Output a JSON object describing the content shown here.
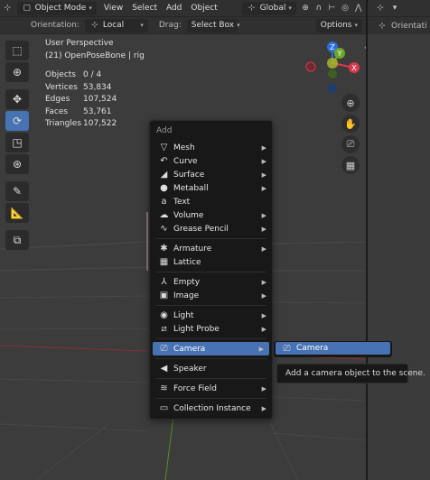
{
  "header": {
    "mode_label": "Object Mode",
    "menu_items": [
      "View",
      "Select",
      "Add",
      "Object"
    ],
    "transform_label": "Global",
    "orientation_label": "Orientation:",
    "orientation_value": "Local",
    "drag_label": "Drag:",
    "drag_value": "Select Box",
    "options_label": "Options"
  },
  "right_panel": {
    "orientation_label": "Orientati"
  },
  "overlay": {
    "perspective": "User Perspective",
    "object_name": "(21) OpenPoseBone | rig",
    "stats": [
      {
        "key": "Objects",
        "value": "0 / 4"
      },
      {
        "key": "Vertices",
        "value": "53,834"
      },
      {
        "key": "Edges",
        "value": "107,524"
      },
      {
        "key": "Faces",
        "value": "53,761"
      },
      {
        "key": "Triangles",
        "value": "107,522"
      }
    ]
  },
  "gizmo": {
    "axes": [
      {
        "name": "Z",
        "color": "#2b70d9"
      },
      {
        "name": "X",
        "color": "#d9384c"
      },
      {
        "name": "Y",
        "color": "#6ea82a"
      }
    ]
  },
  "add_menu": {
    "title": "Add",
    "groups": [
      [
        {
          "label": "Mesh",
          "icon": "mesh-icon",
          "glyph": "▽",
          "submenu": true
        },
        {
          "label": "Curve",
          "icon": "curve-icon",
          "glyph": "↶",
          "submenu": true
        },
        {
          "label": "Surface",
          "icon": "surface-icon",
          "glyph": "◢",
          "submenu": true
        },
        {
          "label": "Metaball",
          "icon": "metaball-icon",
          "glyph": "●",
          "submenu": true
        },
        {
          "label": "Text",
          "icon": "text-icon",
          "glyph": "a",
          "submenu": false
        },
        {
          "label": "Volume",
          "icon": "volume-icon",
          "glyph": "☁",
          "submenu": true
        },
        {
          "label": "Grease Pencil",
          "icon": "grease-pencil-icon",
          "glyph": "∿",
          "submenu": true
        }
      ],
      [
        {
          "label": "Armature",
          "icon": "armature-icon",
          "glyph": "✱",
          "submenu": true
        },
        {
          "label": "Lattice",
          "icon": "lattice-icon",
          "glyph": "▦",
          "submenu": false
        }
      ],
      [
        {
          "label": "Empty",
          "icon": "empty-icon",
          "glyph": "⅄",
          "submenu": true
        },
        {
          "label": "Image",
          "icon": "image-icon",
          "glyph": "▣",
          "submenu": true
        }
      ],
      [
        {
          "label": "Light",
          "icon": "light-icon",
          "glyph": "◉",
          "submenu": true
        },
        {
          "label": "Light Probe",
          "icon": "light-probe-icon",
          "glyph": "⧄",
          "submenu": true
        }
      ],
      [
        {
          "label": "Camera",
          "icon": "camera-icon",
          "glyph": "⎚",
          "submenu": true,
          "highlighted": true
        }
      ],
      [
        {
          "label": "Speaker",
          "icon": "speaker-icon",
          "glyph": "◀",
          "submenu": false
        }
      ],
      [
        {
          "label": "Force Field",
          "icon": "force-field-icon",
          "glyph": "≋",
          "submenu": true
        }
      ],
      [
        {
          "label": "Collection Instance",
          "icon": "collection-instance-icon",
          "glyph": "▭",
          "submenu": true
        }
      ]
    ]
  },
  "camera_submenu": {
    "item_label": "Camera"
  },
  "tooltip": {
    "text": "Add a camera object to the scene."
  },
  "colors": {
    "accent": "#4772b3",
    "menu_bg": "#181818",
    "viewport_bg": "#3c3c3c"
  }
}
